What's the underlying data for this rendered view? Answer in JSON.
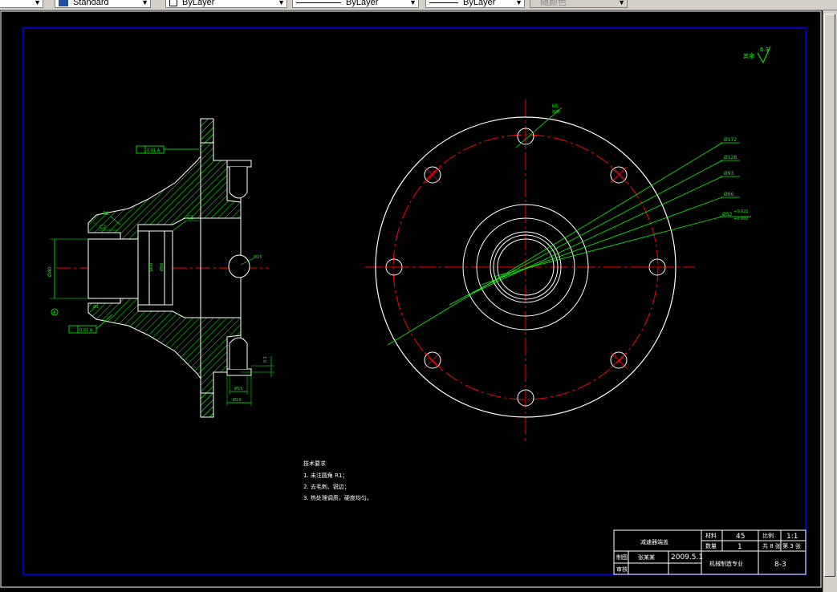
{
  "toolbar": {
    "text_style": "Standard",
    "layer": "ByLayer",
    "linetype": "ByLayer",
    "lineweight": "ByLayer",
    "color": "随颜色"
  },
  "drawing": {
    "surface_roughness": "6.3",
    "roughness_prefix": "其余",
    "dims": {
      "d172": "Ø172",
      "d128": "Ø128",
      "d93": "Ø93",
      "d66": "Ø66",
      "d52": "Ø52",
      "tol_upper": "+0.021",
      "tol_lower": "+0.002",
      "d15": "Ø15",
      "d19": "Ø19",
      "d40": "Ø40",
      "c2a": "C2",
      "c2b": "C2",
      "r2": "R2",
      "hole_note": "6孔\n均布",
      "fcf1": "0.01 A",
      "fcf2": "0.02 A",
      "datum": "A",
      "side_dim": "0.1"
    },
    "tech_req_title": "技术要求",
    "tech_req_1": "1. 未注圆角 R1；",
    "tech_req_2": "2. 去毛刺、锐边；",
    "tech_req_3": "3. 热处理调质，硬度均匀。"
  },
  "title_block": {
    "part_name": "减速器端盖",
    "material_label": "材料",
    "material": "45",
    "scale_label": "比例",
    "scale": "1:1",
    "qty_label": "数量",
    "qty": "1",
    "sheet": "共 8 张 第 3 张",
    "drawn_label": "制图",
    "drawn_name": "张某某",
    "date": "2009.5.1",
    "check_label": "审核",
    "school": "机械制造专业",
    "drawing_no": "8-3"
  },
  "colors": {
    "outline": "#ffffff",
    "center": "#ff0000",
    "dim": "#00ff00",
    "hatch": "#00ff00",
    "border": "#0000ff",
    "title": "#ffffff"
  }
}
